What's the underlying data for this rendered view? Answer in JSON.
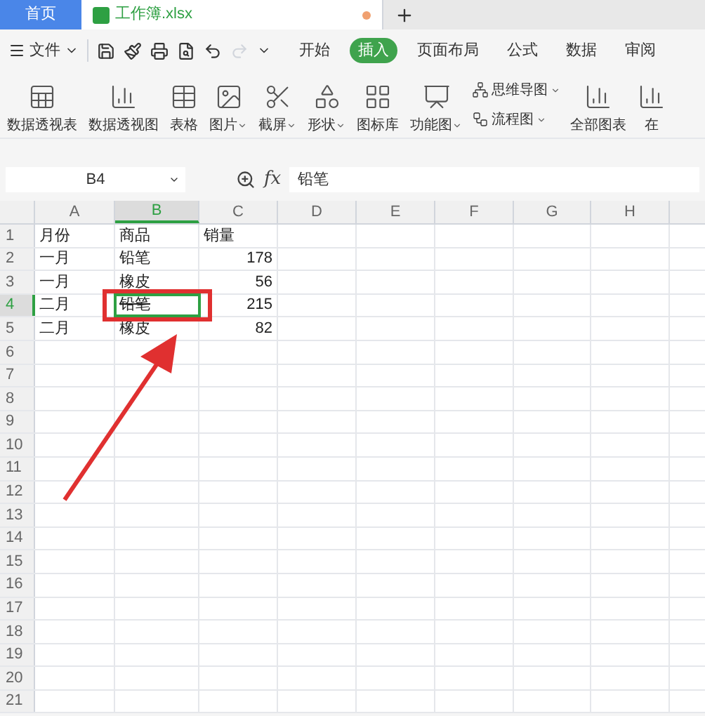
{
  "tabs": [
    {
      "label": "首页",
      "selected": false,
      "kind": "home"
    },
    {
      "label": "工作簿.xlsx",
      "selected": true,
      "kind": "file",
      "unsaved": true
    }
  ],
  "menu": {
    "file": "文件",
    "ribbon_tabs": [
      {
        "label": "开始",
        "selected": false
      },
      {
        "label": "插入",
        "selected": true
      },
      {
        "label": "页面布局",
        "selected": false
      },
      {
        "label": "公式",
        "selected": false
      },
      {
        "label": "数据",
        "selected": false
      },
      {
        "label": "审阅",
        "selected": false
      }
    ]
  },
  "ribbon": [
    {
      "kind": "pivot-table",
      "label": "数据透视表",
      "dropdown": false
    },
    {
      "kind": "pivot-chart",
      "label": "数据透视图",
      "dropdown": false
    },
    {
      "kind": "table",
      "label": "表格",
      "dropdown": false
    },
    {
      "kind": "image",
      "label": "图片",
      "dropdown": true
    },
    {
      "kind": "screenshot",
      "label": "截屏",
      "dropdown": true
    },
    {
      "kind": "shape",
      "label": "形状",
      "dropdown": true
    },
    {
      "kind": "icons",
      "label": "图标库",
      "dropdown": false
    },
    {
      "kind": "function",
      "label": "功能图",
      "dropdown": true
    },
    {
      "kind": "stack",
      "items": [
        {
          "kind": "mindmap",
          "label": "思维导图",
          "dropdown": true
        },
        {
          "kind": "flow",
          "label": "流程图",
          "dropdown": true
        }
      ]
    },
    {
      "kind": "chart",
      "label": "全部图表",
      "dropdown": false
    },
    {
      "kind": "chart",
      "label": "在",
      "dropdown": false
    }
  ],
  "formula_bar": {
    "cell_ref": "B4",
    "fx": "fx",
    "value": "铅笔"
  },
  "sheet": {
    "columns": [
      {
        "label": "A",
        "selected": false
      },
      {
        "label": "B",
        "selected": true
      },
      {
        "label": "C",
        "selected": false
      },
      {
        "label": "D",
        "selected": false
      },
      {
        "label": "E",
        "selected": false
      },
      {
        "label": "F",
        "selected": false
      },
      {
        "label": "G",
        "selected": false
      },
      {
        "label": "H",
        "selected": false
      }
    ],
    "rows": [
      {
        "label": "1",
        "selected": false,
        "cells": [
          {
            "text": "月份",
            "kind": "text",
            "struck": false
          },
          {
            "text": "商品",
            "kind": "text",
            "struck": false
          },
          {
            "text": "销量",
            "kind": "text",
            "struck": false
          }
        ]
      },
      {
        "label": "2",
        "selected": false,
        "cells": [
          {
            "text": "一月",
            "kind": "text",
            "struck": false
          },
          {
            "text": "铅笔",
            "kind": "text",
            "struck": false
          },
          {
            "text": "178",
            "kind": "number",
            "struck": false
          }
        ]
      },
      {
        "label": "3",
        "selected": false,
        "cells": [
          {
            "text": "一月",
            "kind": "text",
            "struck": false
          },
          {
            "text": "橡皮",
            "kind": "text",
            "struck": false
          },
          {
            "text": "56",
            "kind": "number",
            "struck": false
          }
        ]
      },
      {
        "label": "4",
        "selected": true,
        "cells": [
          {
            "text": "二月",
            "kind": "text",
            "struck": false
          },
          {
            "text": "铅笔",
            "kind": "text",
            "struck": true
          },
          {
            "text": "215",
            "kind": "number",
            "struck": false
          }
        ]
      },
      {
        "label": "5",
        "selected": false,
        "cells": [
          {
            "text": "二月",
            "kind": "text",
            "struck": false
          },
          {
            "text": "橡皮",
            "kind": "text",
            "struck": false
          },
          {
            "text": "82",
            "kind": "number",
            "struck": false
          }
        ]
      },
      {
        "label": "6",
        "selected": false
      },
      {
        "label": "7",
        "selected": false
      },
      {
        "label": "8",
        "selected": false
      },
      {
        "label": "9",
        "selected": false
      },
      {
        "label": "10",
        "selected": false
      },
      {
        "label": "11",
        "selected": false
      },
      {
        "label": "12",
        "selected": false
      },
      {
        "label": "13",
        "selected": false
      },
      {
        "label": "14",
        "selected": false
      },
      {
        "label": "15",
        "selected": false
      },
      {
        "label": "16",
        "selected": false
      },
      {
        "label": "17",
        "selected": false
      },
      {
        "label": "18",
        "selected": false
      },
      {
        "label": "19",
        "selected": false
      },
      {
        "label": "20",
        "selected": false
      },
      {
        "label": "21",
        "selected": false
      }
    ]
  }
}
